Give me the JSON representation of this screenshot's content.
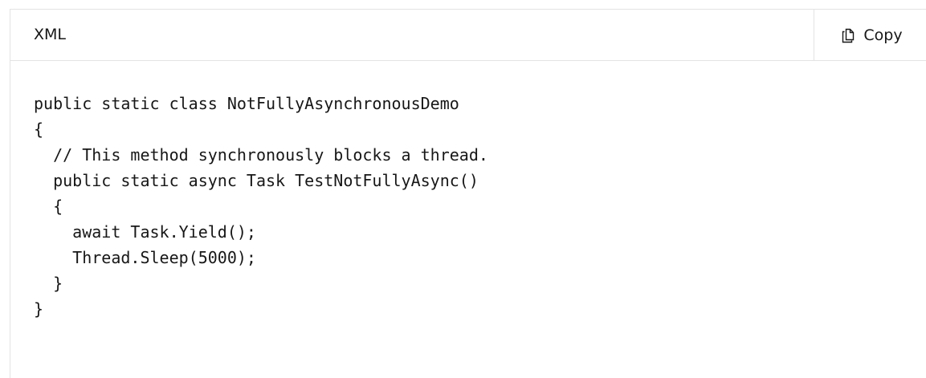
{
  "code_block": {
    "language": "XML",
    "copy_label": "Copy",
    "copy_icon": "copy-icon",
    "lines": [
      "public static class NotFullyAsynchronousDemo",
      "{",
      "  // This method synchronously blocks a thread.",
      "  public static async Task TestNotFullyAsync()",
      "  {",
      "    await Task.Yield();",
      "    Thread.Sleep(5000);",
      "  }",
      "}"
    ]
  }
}
